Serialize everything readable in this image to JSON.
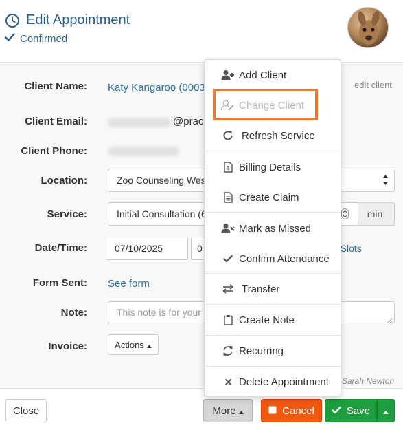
{
  "header": {
    "title": "Edit Appointment",
    "status": "Confirmed",
    "accent_color": "#2b5f8a"
  },
  "form": {
    "client_name": {
      "label": "Client Name:",
      "value": "Katy Kangaroo (0003"
    },
    "edit_client_link": "edit client",
    "client_email": {
      "label": "Client Email:",
      "value_suffix": "@prac"
    },
    "client_phone": {
      "label": "Client Phone:"
    },
    "location": {
      "label": "Location:",
      "value": "Zoo Counseling Wes"
    },
    "service": {
      "label": "Service:",
      "value": "Initial Consultation (6",
      "unit": "min."
    },
    "datetime": {
      "label": "Date/Time:",
      "date": "07/10/2025",
      "time_partial": "0",
      "slots_link": "n Slots"
    },
    "form_sent": {
      "label": "Form Sent:",
      "link": "See form"
    },
    "note": {
      "label": "Note:",
      "placeholder": "This note is for your"
    },
    "invoice": {
      "label": "Invoice:",
      "actions_label": "Actions"
    }
  },
  "menu": {
    "items": [
      {
        "label": "Add Client",
        "icon": "user-plus-icon",
        "disabled": false
      },
      {
        "label": "Change Client",
        "icon": "user-edit-icon",
        "disabled": true
      },
      {
        "label": "Refresh Service",
        "icon": "refresh-icon",
        "disabled": false
      },
      {
        "label": "Billing Details",
        "icon": "file-dollar-icon",
        "disabled": false
      },
      {
        "label": "Create Claim",
        "icon": "file-text-icon",
        "disabled": false
      },
      {
        "label": "Mark as Missed",
        "icon": "user-times-icon",
        "disabled": false
      },
      {
        "label": "Confirm Attendance",
        "icon": "check-icon",
        "disabled": false
      },
      {
        "label": "Transfer",
        "icon": "exchange-icon",
        "disabled": false
      },
      {
        "label": "Create Note",
        "icon": "clipboard-icon",
        "disabled": false
      },
      {
        "label": "Recurring",
        "icon": "recurring-icon",
        "disabled": false
      },
      {
        "label": "Delete Appointment",
        "icon": "times-icon",
        "disabled": false
      }
    ],
    "highlight_color": "#e07b39"
  },
  "footer": {
    "close_label": "Close",
    "more_label": "More",
    "cancel_label": "Cancel",
    "save_label": "Save",
    "signature": "Sarah Newton",
    "cancel_color": "#f05a0e",
    "save_color": "#1e9e3e"
  }
}
